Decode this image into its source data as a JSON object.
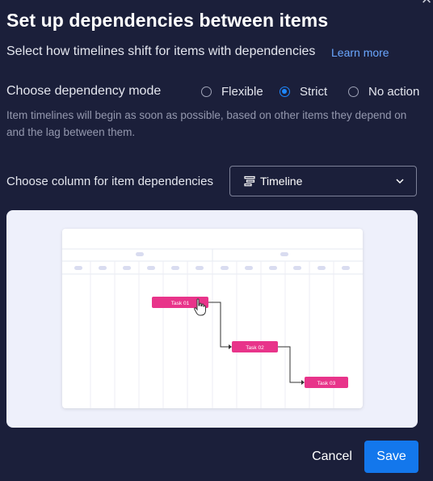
{
  "dialog": {
    "title": "Set up dependencies between items",
    "subtitle": "Select how timelines shift for items with dependencies",
    "learn_more": "Learn more"
  },
  "mode": {
    "label": "Choose dependency mode",
    "options": [
      {
        "label": "Flexible",
        "checked": false
      },
      {
        "label": "Strict",
        "checked": true
      },
      {
        "label": "No action",
        "checked": false
      }
    ],
    "description": "Item timelines will begin as soon as possible, based on other items they depend on and the lag between them."
  },
  "column": {
    "label": "Choose column for item dependencies",
    "selected": "Timeline",
    "icon": "timeline-icon"
  },
  "preview": {
    "tasks": [
      "Task 01",
      "Task 02",
      "Task 03"
    ],
    "task_color": "#e8348a"
  },
  "footer": {
    "cancel": "Cancel",
    "save": "Save"
  },
  "colors": {
    "background": "#1b1f3a",
    "accent": "#1377ec",
    "link": "#6aa7ff"
  }
}
